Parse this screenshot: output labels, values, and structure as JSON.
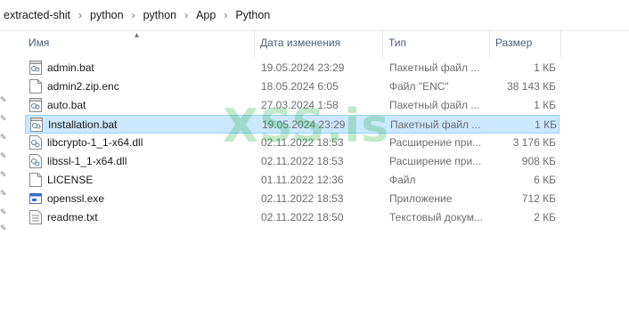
{
  "breadcrumb": [
    "extracted-shit",
    "python",
    "python",
    "App",
    "Python"
  ],
  "columns": {
    "name": "Имя",
    "date": "Дата изменения",
    "type": "Тип",
    "size": "Размер"
  },
  "files": [
    {
      "name": "admin.bat",
      "date": "19.05.2024 23:29",
      "type": "Пакетный файл ...",
      "size": "1 КБ",
      "icon": "batch-file-icon"
    },
    {
      "name": "admin2.zip.enc",
      "date": "18.05.2024 6:05",
      "type": "Файл \"ENC\"",
      "size": "38 143 КБ",
      "icon": "file-icon"
    },
    {
      "name": "auto.bat",
      "date": "27.03.2024 1:58",
      "type": "Пакетный файл ...",
      "size": "1 КБ",
      "icon": "batch-file-icon"
    },
    {
      "name": "Installation.bat",
      "date": "19.05.2024 23:29",
      "type": "Пакетный файл ...",
      "size": "1 КБ",
      "icon": "batch-file-icon"
    },
    {
      "name": "libcrypto-1_1-x64.dll",
      "date": "02.11.2022 18:53",
      "type": "Расширение при...",
      "size": "3 176 КБ",
      "icon": "dll-file-icon"
    },
    {
      "name": "libssl-1_1-x64.dll",
      "date": "02.11.2022 18:53",
      "type": "Расширение при...",
      "size": "908 КБ",
      "icon": "dll-file-icon"
    },
    {
      "name": "LICENSE",
      "date": "01.11.2022 12:36",
      "type": "Файл",
      "size": "6 КБ",
      "icon": "file-icon"
    },
    {
      "name": "openssl.exe",
      "date": "02.11.2022 18:53",
      "type": "Приложение",
      "size": "712 КБ",
      "icon": "exe-file-icon"
    },
    {
      "name": "readme.txt",
      "date": "02.11.2022 18:50",
      "type": "Текстовый докум...",
      "size": "2 КБ",
      "icon": "text-file-icon"
    }
  ],
  "selected_index": 3,
  "watermark": "XSS.is",
  "colors": {
    "selection_bg": "#cce8ff",
    "selection_border": "#99d1ff",
    "header_text": "#4c607a",
    "watermark": "#29b34a"
  }
}
